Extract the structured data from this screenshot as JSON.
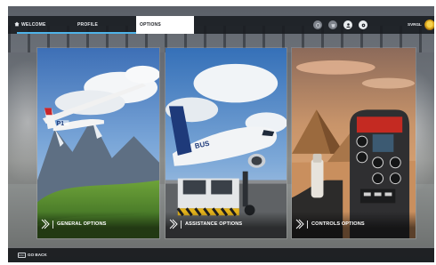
{
  "topbar": {
    "tabs": [
      {
        "label": "WELCOME"
      },
      {
        "label": "PROFILE"
      },
      {
        "label": "OPTIONS"
      }
    ],
    "username": "SVRGL"
  },
  "cards": [
    {
      "label": "GENERAL OPTIONS"
    },
    {
      "label": "ASSISTANCE OPTIONS"
    },
    {
      "label": "CONTROLS OPTIONS"
    }
  ],
  "bottombar": {
    "key_label": "ESC",
    "back_label": "GO BACK"
  },
  "colors": {
    "accent": "#4fb3e8",
    "bar": "#181b20",
    "active_tab": "#ffffff"
  }
}
